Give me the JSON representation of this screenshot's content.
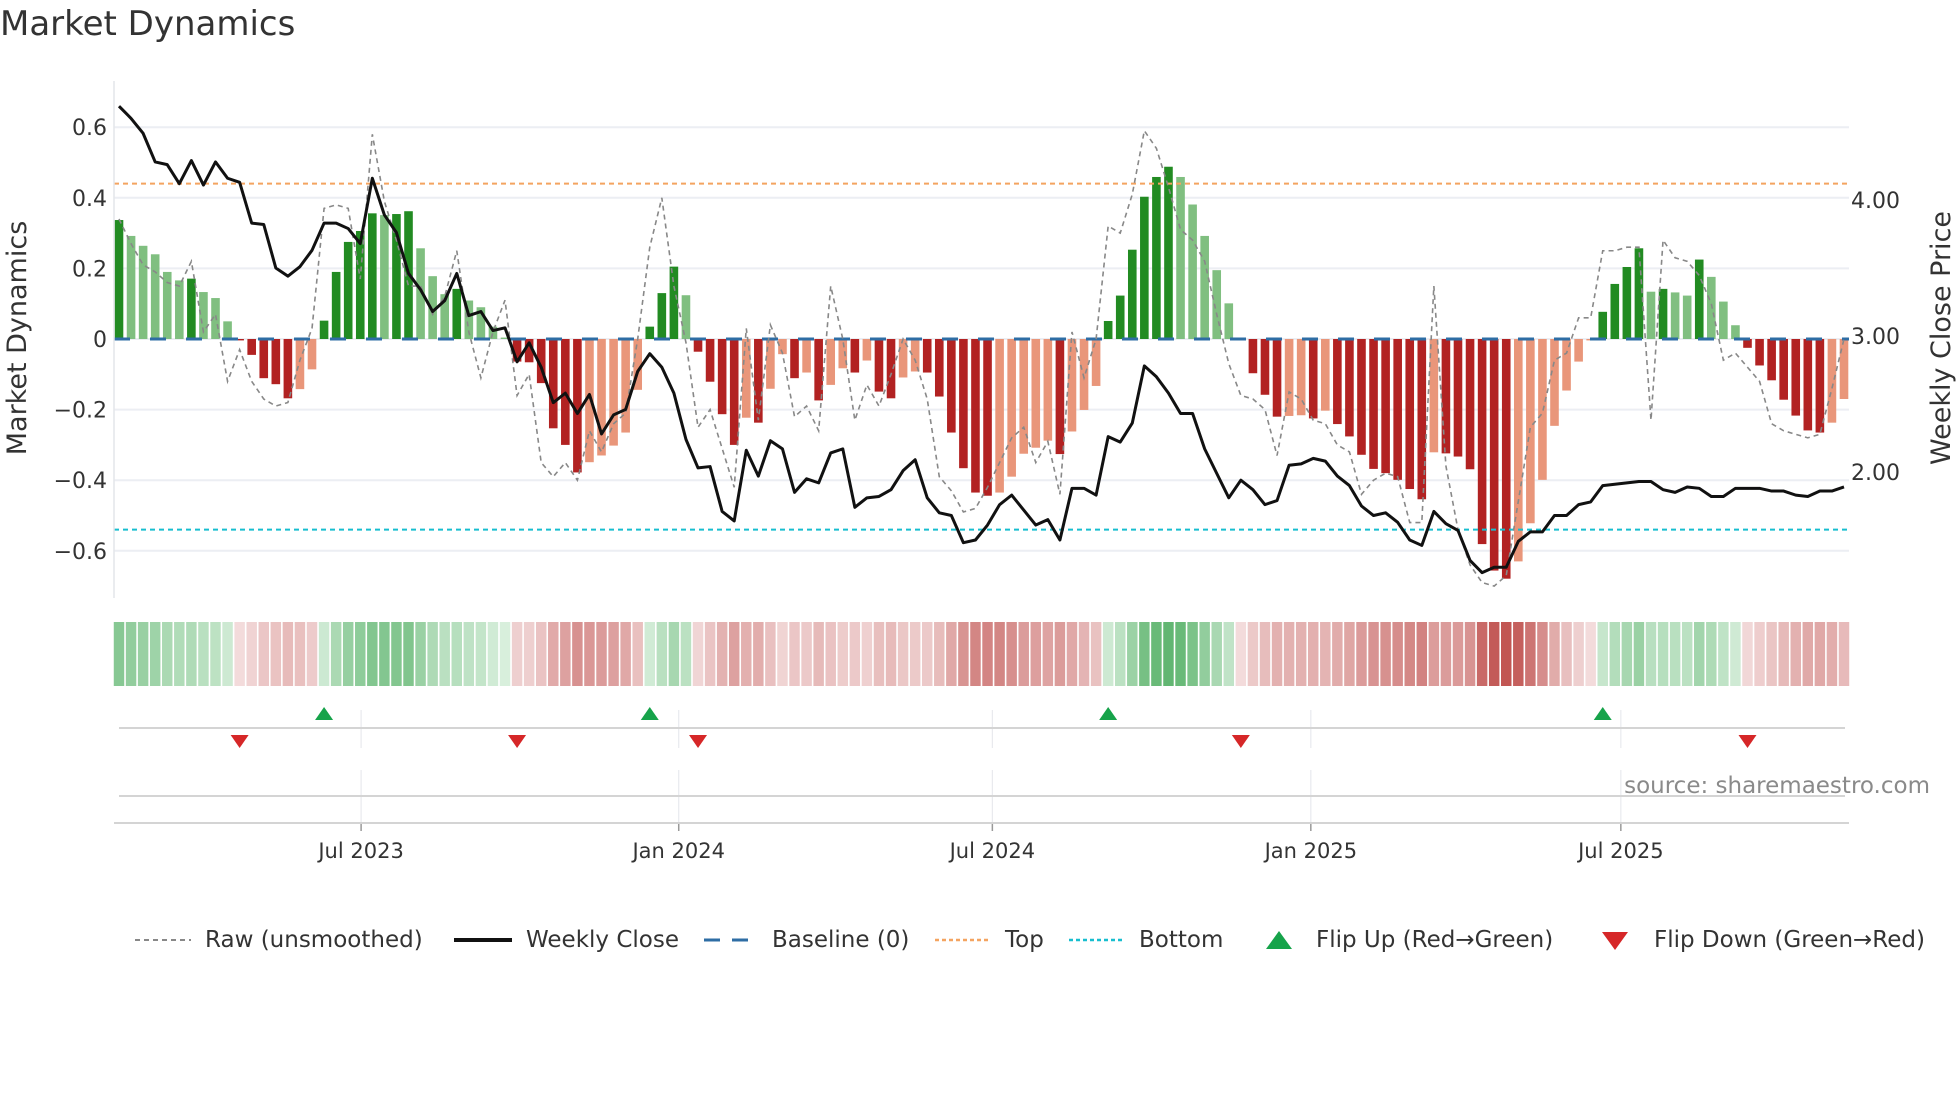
{
  "title": "Market Dynamics",
  "source": "source: sharemaestro.com",
  "legend": {
    "raw": "Raw (unsmoothed)",
    "close": "Weekly Close",
    "baseline": "Baseline (0)",
    "top": "Top",
    "bottom": "Bottom",
    "flip_up": "Flip Up (Red→Green)",
    "flip_down": "Flip Down (Green→Red)"
  },
  "colors": {
    "green_strong": "#228b22",
    "green_weak": "#80bf80",
    "red_strong": "#b22222",
    "red_weak": "#e9967a",
    "raw": "#888888",
    "close": "#111111",
    "baseline": "#2e6da4",
    "top": "#f4a460",
    "bottom": "#17becf",
    "flip_up": "#16a34a",
    "flip_down": "#d62728"
  },
  "chart_data": {
    "type": "bar",
    "title": "Market Dynamics",
    "ylabel": "Market Dynamics",
    "y2label": "Weekly Close Price",
    "ylim": [
      -0.72,
      0.74
    ],
    "y_ticks": [
      "0.6",
      "0.4",
      "0.2",
      "0",
      "−0.2",
      "−0.4",
      "−0.6"
    ],
    "y_tick_values": [
      0.6,
      0.4,
      0.2,
      0,
      -0.2,
      -0.4,
      -0.6
    ],
    "y2_ticks": [
      "4.00",
      "3.00",
      "2.00"
    ],
    "y2_tick_values": [
      4,
      3,
      2
    ],
    "x_ticks": [
      "Jul 2023",
      "Jan 2024",
      "Jul 2024",
      "Jan 2025",
      "Jul 2025"
    ],
    "top_level": 0.44,
    "bottom_level": -0.54,
    "baseline": 0,
    "frequency": "weekly",
    "series": [
      {
        "name": "Market Dynamics (smoothed)",
        "values": [
          0.337,
          0.292,
          0.264,
          0.24,
          0.19,
          0.166,
          0.171,
          0.133,
          0.116,
          0.05,
          -0.004,
          -0.045,
          -0.111,
          -0.128,
          -0.168,
          -0.142,
          -0.086,
          0.052,
          0.19,
          0.275,
          0.306,
          0.356,
          0.351,
          0.354,
          0.362,
          0.257,
          0.178,
          0.127,
          0.142,
          0.109,
          0.09,
          0.035,
          0.004,
          -0.064,
          -0.066,
          -0.125,
          -0.253,
          -0.3,
          -0.378,
          -0.349,
          -0.33,
          -0.302,
          -0.265,
          -0.144,
          0.035,
          0.13,
          0.205,
          0.124,
          -0.036,
          -0.121,
          -0.213,
          -0.3,
          -0.223,
          -0.237,
          -0.141,
          -0.043,
          -0.111,
          -0.095,
          -0.174,
          -0.13,
          -0.083,
          -0.095,
          -0.061,
          -0.149,
          -0.168,
          -0.109,
          -0.092,
          -0.095,
          -0.163,
          -0.265,
          -0.366,
          -0.435,
          -0.444,
          -0.435,
          -0.39,
          -0.325,
          -0.308,
          -0.288,
          -0.326,
          -0.262,
          -0.201,
          -0.133,
          0.051,
          0.123,
          0.253,
          0.403,
          0.459,
          0.488,
          0.459,
          0.381,
          0.292,
          0.195,
          0.101,
          -0.004,
          -0.097,
          -0.158,
          -0.22,
          -0.218,
          -0.216,
          -0.225,
          -0.203,
          -0.241,
          -0.276,
          -0.328,
          -0.368,
          -0.38,
          -0.399,
          -0.425,
          -0.454,
          -0.321,
          -0.324,
          -0.333,
          -0.369,
          -0.581,
          -0.656,
          -0.679,
          -0.63,
          -0.522,
          -0.399,
          -0.246,
          -0.146,
          -0.064,
          -0.004,
          0.077,
          0.156,
          0.204,
          0.257,
          0.134,
          0.142,
          0.132,
          0.123,
          0.225,
          0.176,
          0.106,
          0.039,
          -0.025,
          -0.075,
          -0.117,
          -0.172,
          -0.217,
          -0.259,
          -0.265,
          -0.237,
          -0.17
        ]
      },
      {
        "name": "Raw (unsmoothed)",
        "values": [
          0.34,
          0.27,
          0.21,
          0.19,
          0.16,
          0.15,
          0.22,
          0.02,
          0.07,
          -0.12,
          -0.03,
          -0.12,
          -0.17,
          -0.19,
          -0.18,
          -0.06,
          0.03,
          0.37,
          0.38,
          0.37,
          0.17,
          0.58,
          0.39,
          0.28,
          0.15,
          0.15,
          0.07,
          0.12,
          0.25,
          0.02,
          -0.11,
          0.02,
          0.11,
          -0.16,
          -0.1,
          -0.35,
          -0.39,
          -0.35,
          -0.4,
          -0.26,
          -0.32,
          -0.24,
          -0.21,
          0,
          0.26,
          0.4,
          0.15,
          -0.01,
          -0.25,
          -0.2,
          -0.31,
          -0.42,
          0.03,
          -0.23,
          0.04,
          -0.04,
          -0.22,
          -0.19,
          -0.26,
          0.15,
          0,
          -0.23,
          -0.13,
          -0.19,
          -0.1,
          0,
          -0.06,
          -0.17,
          -0.39,
          -0.43,
          -0.49,
          -0.48,
          -0.42,
          -0.35,
          -0.28,
          -0.25,
          -0.35,
          -0.29,
          -0.44,
          0.02,
          -0.11,
          0,
          0.32,
          0.3,
          0.41,
          0.59,
          0.54,
          0.43,
          0.31,
          0.28,
          0.22,
          0.07,
          -0.07,
          -0.16,
          -0.17,
          -0.2,
          -0.33,
          -0.15,
          -0.17,
          -0.23,
          -0.24,
          -0.3,
          -0.32,
          -0.44,
          -0.4,
          -0.38,
          -0.39,
          -0.52,
          -0.52,
          0.15,
          -0.36,
          -0.54,
          -0.64,
          -0.69,
          -0.7,
          -0.67,
          -0.46,
          -0.25,
          -0.21,
          -0.06,
          -0.04,
          0.06,
          0.06,
          0.25,
          0.25,
          0.26,
          0.26,
          -0.23,
          0.28,
          0.23,
          0.22,
          0.18,
          0.1,
          -0.06,
          -0.04,
          -0.08,
          -0.12,
          -0.24,
          -0.26,
          -0.27,
          -0.28,
          -0.27,
          -0.14,
          0
        ]
      },
      {
        "name": "Weekly Close",
        "axis": "right",
        "values": [
          4.69,
          4.6,
          4.49,
          4.28,
          4.26,
          4.12,
          4.29,
          4.11,
          4.28,
          4.16,
          4.13,
          3.83,
          3.82,
          3.5,
          3.44,
          3.51,
          3.63,
          3.83,
          3.83,
          3.79,
          3.68,
          4.16,
          3.89,
          3.76,
          3.46,
          3.34,
          3.18,
          3.26,
          3.46,
          3.15,
          3.18,
          3.04,
          3.06,
          2.81,
          2.95,
          2.77,
          2.51,
          2.58,
          2.43,
          2.57,
          2.28,
          2.42,
          2.46,
          2.74,
          2.87,
          2.77,
          2.58,
          2.24,
          2.03,
          2.04,
          1.71,
          1.64,
          2.16,
          1.97,
          2.23,
          2.17,
          1.85,
          1.95,
          1.92,
          2.14,
          2.17,
          1.74,
          1.81,
          1.82,
          1.87,
          2.01,
          2.09,
          1.81,
          1.7,
          1.68,
          1.48,
          1.5,
          1.61,
          1.76,
          1.83,
          1.72,
          1.61,
          1.65,
          1.5,
          1.88,
          1.88,
          1.83,
          2.26,
          2.22,
          2.36,
          2.78,
          2.7,
          2.58,
          2.43,
          2.43,
          2.17,
          1.99,
          1.81,
          1.94,
          1.87,
          1.76,
          1.79,
          2.05,
          2.06,
          2.1,
          2.08,
          1.97,
          1.9,
          1.75,
          1.68,
          1.7,
          1.63,
          1.5,
          1.46,
          1.71,
          1.62,
          1.57,
          1.35,
          1.26,
          1.3,
          1.3,
          1.49,
          1.56,
          1.56,
          1.68,
          1.68,
          1.76,
          1.78,
          1.9,
          1.91,
          1.92,
          1.93,
          1.93,
          1.87,
          1.85,
          1.89,
          1.88,
          1.82,
          1.82,
          1.88,
          1.88,
          1.88,
          1.86,
          1.86,
          1.83,
          1.82,
          1.86,
          1.86,
          1.89
        ]
      }
    ]
  }
}
